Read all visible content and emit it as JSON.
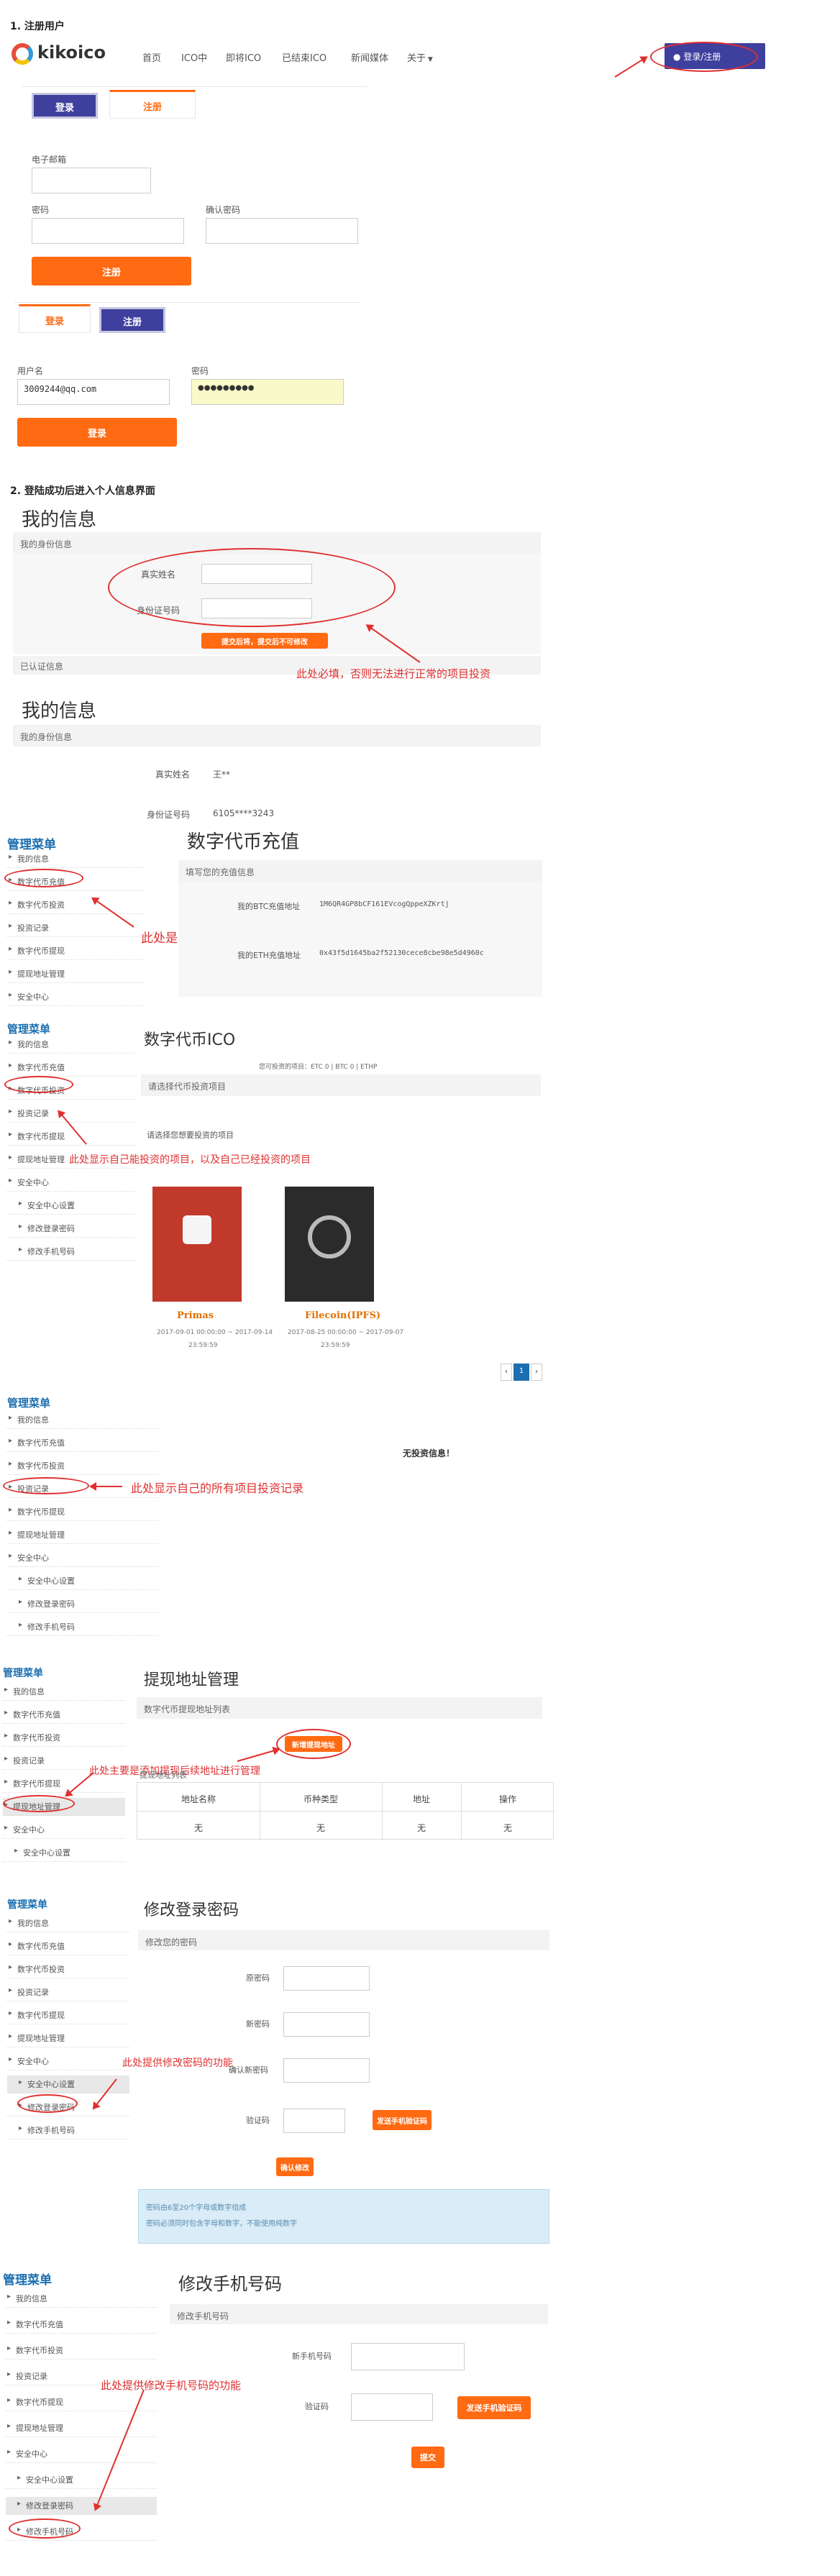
{
  "steps": {
    "s1": "1. 注册用户",
    "s2": "2. 登陆成功后进入个人信息界面"
  },
  "header": {
    "logo": "kikoico",
    "nav": [
      "首页",
      "ICO中",
      "即将ICO",
      "已结束ICO",
      "新闻媒体",
      "关于"
    ],
    "login_btn": "登录/注册"
  },
  "register": {
    "tab_login": "登录",
    "tab_register": "注册",
    "email_label": "电子邮箱",
    "password_label": "密码",
    "confirm_label": "确认密码",
    "submit": "注册"
  },
  "login": {
    "tab_login": "登录",
    "tab_register": "注册",
    "user_label": "用户名",
    "user_value": "3009244@qq.com",
    "pwd_label": "密码",
    "pwd_value": "●●●●●●●●●",
    "submit": "登录"
  },
  "info1": {
    "title": "我的信息",
    "sec_identity": "我的身份信息",
    "realname_label": "真实姓名",
    "idcard_label": "身份证号码",
    "submit": "提交后将，提交后不可修改",
    "sec_bottom": "已认证信息",
    "note": "此处必填，否则无法进行正常的项目投资"
  },
  "info2": {
    "title": "我的信息",
    "sec_identity": "我的身份信息",
    "realname_label": "真实姓名",
    "realname_value": "王**",
    "idcard_label": "身份证号码",
    "idcard_value": "6105****3243"
  },
  "menu": {
    "title": "管理菜单",
    "items": [
      "我的信息",
      "数字代币充值",
      "数字代币投资",
      "投资记录",
      "数字代币提现",
      "提现地址管理",
      "安全中心"
    ],
    "sub": [
      "安全中心设置",
      "修改登录密码",
      "修改手机号码"
    ]
  },
  "recharge": {
    "title": "数字代币充值",
    "sec": "填写您的充值信息",
    "btc_label": "我的BTC充值地址",
    "btc_value": "1M6QR4GP8bCF161EVcogQppeXZKrtj",
    "eth_label": "我的ETH充值地址",
    "eth_value": "0x43f5d1645ba2f52130cece8cbe98e5d4960c",
    "note": "此处是自己的代币充值地址"
  },
  "projects": {
    "title": "数字代币ICO",
    "sub": "您可投资的项目：ETC 0 | BTC 0 | ETHP",
    "sec": "请选择代币投资项目",
    "hint": "请选择您想要投资的项目",
    "p1_name": "Primas",
    "p1_time": "2017-09-01 00:00:00 ~ 2017-09-14",
    "p1_extra": "23:59:59",
    "p2_name": "Filecoin(IPFS)",
    "p2_time": "2017-08-25 00:00:00 ~ 2017-09-07",
    "p2_extra": "23:59:59",
    "page": "1",
    "note": "此处显示自己能投资的项目，以及自己已经投资的项目"
  },
  "records": {
    "empty": "无投资信息！",
    "note": "此处显示自己的所有项目投资记录"
  },
  "address": {
    "title": "提现地址管理",
    "sec": "数字代币提现地址列表",
    "add_btn": "新增提现地址",
    "table_caption": "提现地址列表",
    "headers": [
      "地址名称",
      "币种类型",
      "地址",
      "操作"
    ],
    "row": [
      "无",
      "无",
      "无",
      "无"
    ],
    "note": "此处主要是添加提现后续地址进行管理"
  },
  "pwd": {
    "title": "修改登录密码",
    "sec": "修改您的密码",
    "old_label": "原密码",
    "new_label": "新密码",
    "confirm_label": "确认新密码",
    "code_label": "验证码",
    "send_btn": "发送手机验证码",
    "submit": "确认修改",
    "tip1": "密码由6至20个字母或数字组成",
    "tip2": "密码必须同时包含字母和数字，不能使用纯数字",
    "note": "此处提供修改密码的功能"
  },
  "phone": {
    "title": "修改手机号码",
    "sec": "修改手机号码",
    "new_label": "新手机号码",
    "code_label": "验证码",
    "send_btn": "发送手机验证码",
    "submit": "提交",
    "note": "此处提供修改手机号码的功能"
  }
}
